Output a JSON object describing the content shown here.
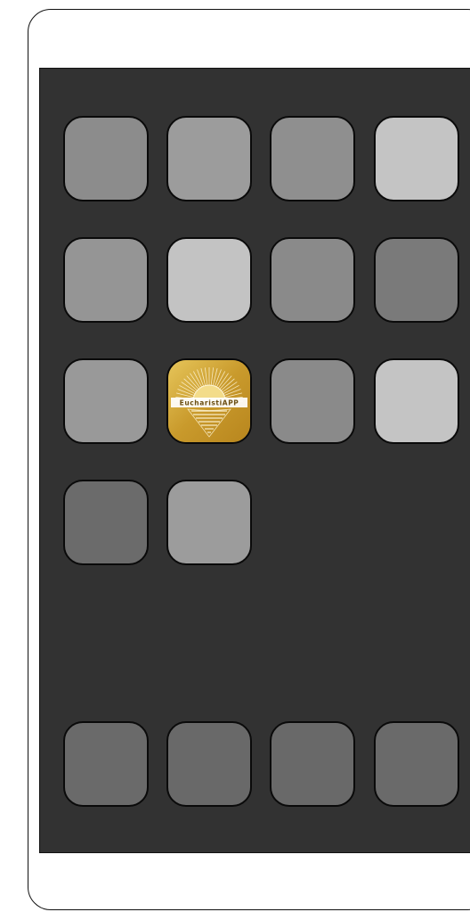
{
  "home_screen": {
    "app_rows": [
      [
        {
          "color": "#8c8c8c"
        },
        {
          "color": "#9c9c9c"
        },
        {
          "color": "#8f8f8f"
        },
        {
          "color": "#c4c4c4"
        }
      ],
      [
        {
          "color": "#959595"
        },
        {
          "color": "#c3c3c3"
        },
        {
          "color": "#8a8a8a"
        },
        {
          "color": "#7a7a7a"
        }
      ],
      [
        {
          "color": "#999999"
        },
        {
          "featured": true,
          "label": "EucharistiAPP",
          "color": "#c9a032",
          "icon": "sunrise-heart-icon"
        },
        {
          "color": "#8a8a8a"
        },
        {
          "color": "#c4c4c4"
        }
      ],
      [
        {
          "color": "#6b6b6b"
        },
        {
          "color": "#9c9c9c"
        }
      ]
    ],
    "dock": [
      {
        "color": "#6a6a6a"
      },
      {
        "color": "#696969"
      },
      {
        "color": "#696969"
      },
      {
        "color": "#6a6a6a"
      }
    ]
  }
}
